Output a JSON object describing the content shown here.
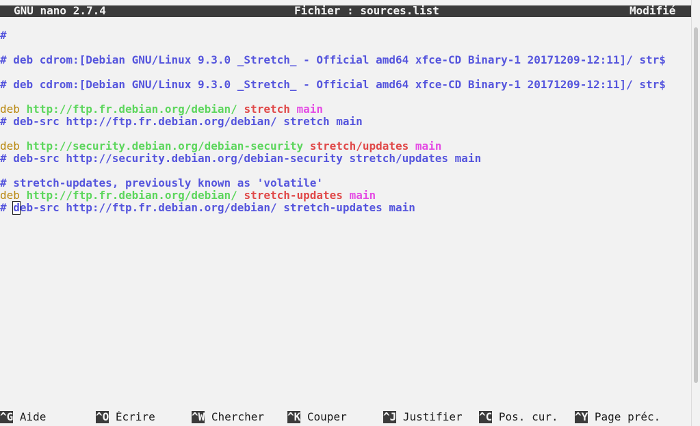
{
  "title_bar": {
    "app": "GNU nano 2.7.4",
    "file_label": "Fichier : sources.list",
    "status": "Modifié"
  },
  "editor_lines": [
    [
      {
        "t": "#",
        "c": "comment"
      }
    ],
    [],
    [
      {
        "t": "# deb cdrom:[Debian GNU/Linux 9.3.0 _Stretch_ - Official amd64 xfce-CD Binary-1 20171209-12:11]/ str$",
        "c": "comment"
      }
    ],
    [],
    [
      {
        "t": "# deb cdrom:[Debian GNU/Linux 9.3.0 _Stretch_ - Official amd64 xfce-CD Binary-1 20171209-12:11]/ str$",
        "c": "comment"
      }
    ],
    [],
    [
      {
        "t": "deb",
        "c": "deb"
      },
      {
        "t": " ",
        "c": "plain"
      },
      {
        "t": "http://ftp.fr.debian.org/debian/",
        "c": "url"
      },
      {
        "t": " ",
        "c": "plain"
      },
      {
        "t": "stretch",
        "c": "suite"
      },
      {
        "t": " ",
        "c": "plain"
      },
      {
        "t": "main",
        "c": "comp"
      }
    ],
    [
      {
        "t": "# deb-src http://ftp.fr.debian.org/debian/ stretch main",
        "c": "comment"
      }
    ],
    [],
    [
      {
        "t": "deb",
        "c": "deb"
      },
      {
        "t": " ",
        "c": "plain"
      },
      {
        "t": "http://security.debian.org/debian-security",
        "c": "url"
      },
      {
        "t": " ",
        "c": "plain"
      },
      {
        "t": "stretch/updates",
        "c": "suite"
      },
      {
        "t": " ",
        "c": "plain"
      },
      {
        "t": "main",
        "c": "comp"
      }
    ],
    [
      {
        "t": "# deb-src http://security.debian.org/debian-security stretch/updates main",
        "c": "comment"
      }
    ],
    [],
    [
      {
        "t": "# stretch-updates, previously known as 'volatile'",
        "c": "comment"
      }
    ],
    [
      {
        "t": "deb",
        "c": "deb"
      },
      {
        "t": " ",
        "c": "plain"
      },
      {
        "t": "http://ftp.fr.debian.org/debian/",
        "c": "url"
      },
      {
        "t": " ",
        "c": "plain"
      },
      {
        "t": "stretch-updates",
        "c": "suite"
      },
      {
        "t": " ",
        "c": "plain"
      },
      {
        "t": "main",
        "c": "comp"
      }
    ],
    [
      {
        "t": "# ",
        "c": "comment"
      },
      {
        "t": "d",
        "c": "comment",
        "cursor": true
      },
      {
        "t": "eb-src http://ftp.fr.debian.org/debian/ stretch-updates main",
        "c": "comment"
      }
    ]
  ],
  "shortcuts": [
    {
      "key": "^G",
      "label": "Aide"
    },
    {
      "key": "^O",
      "label": "Écrire"
    },
    {
      "key": "^W",
      "label": "Chercher"
    },
    {
      "key": "^K",
      "label": "Couper"
    },
    {
      "key": "^J",
      "label": "Justifier"
    },
    {
      "key": "^C",
      "label": "Pos. cur."
    },
    {
      "key": "^Y",
      "label": "Page préc."
    }
  ],
  "colors": {
    "comment": "#5555dd",
    "deb": "#b8860b",
    "url": "#5cd65c",
    "suite": "#e04848",
    "component": "#e44be4",
    "bar": "#3b3b3b"
  }
}
